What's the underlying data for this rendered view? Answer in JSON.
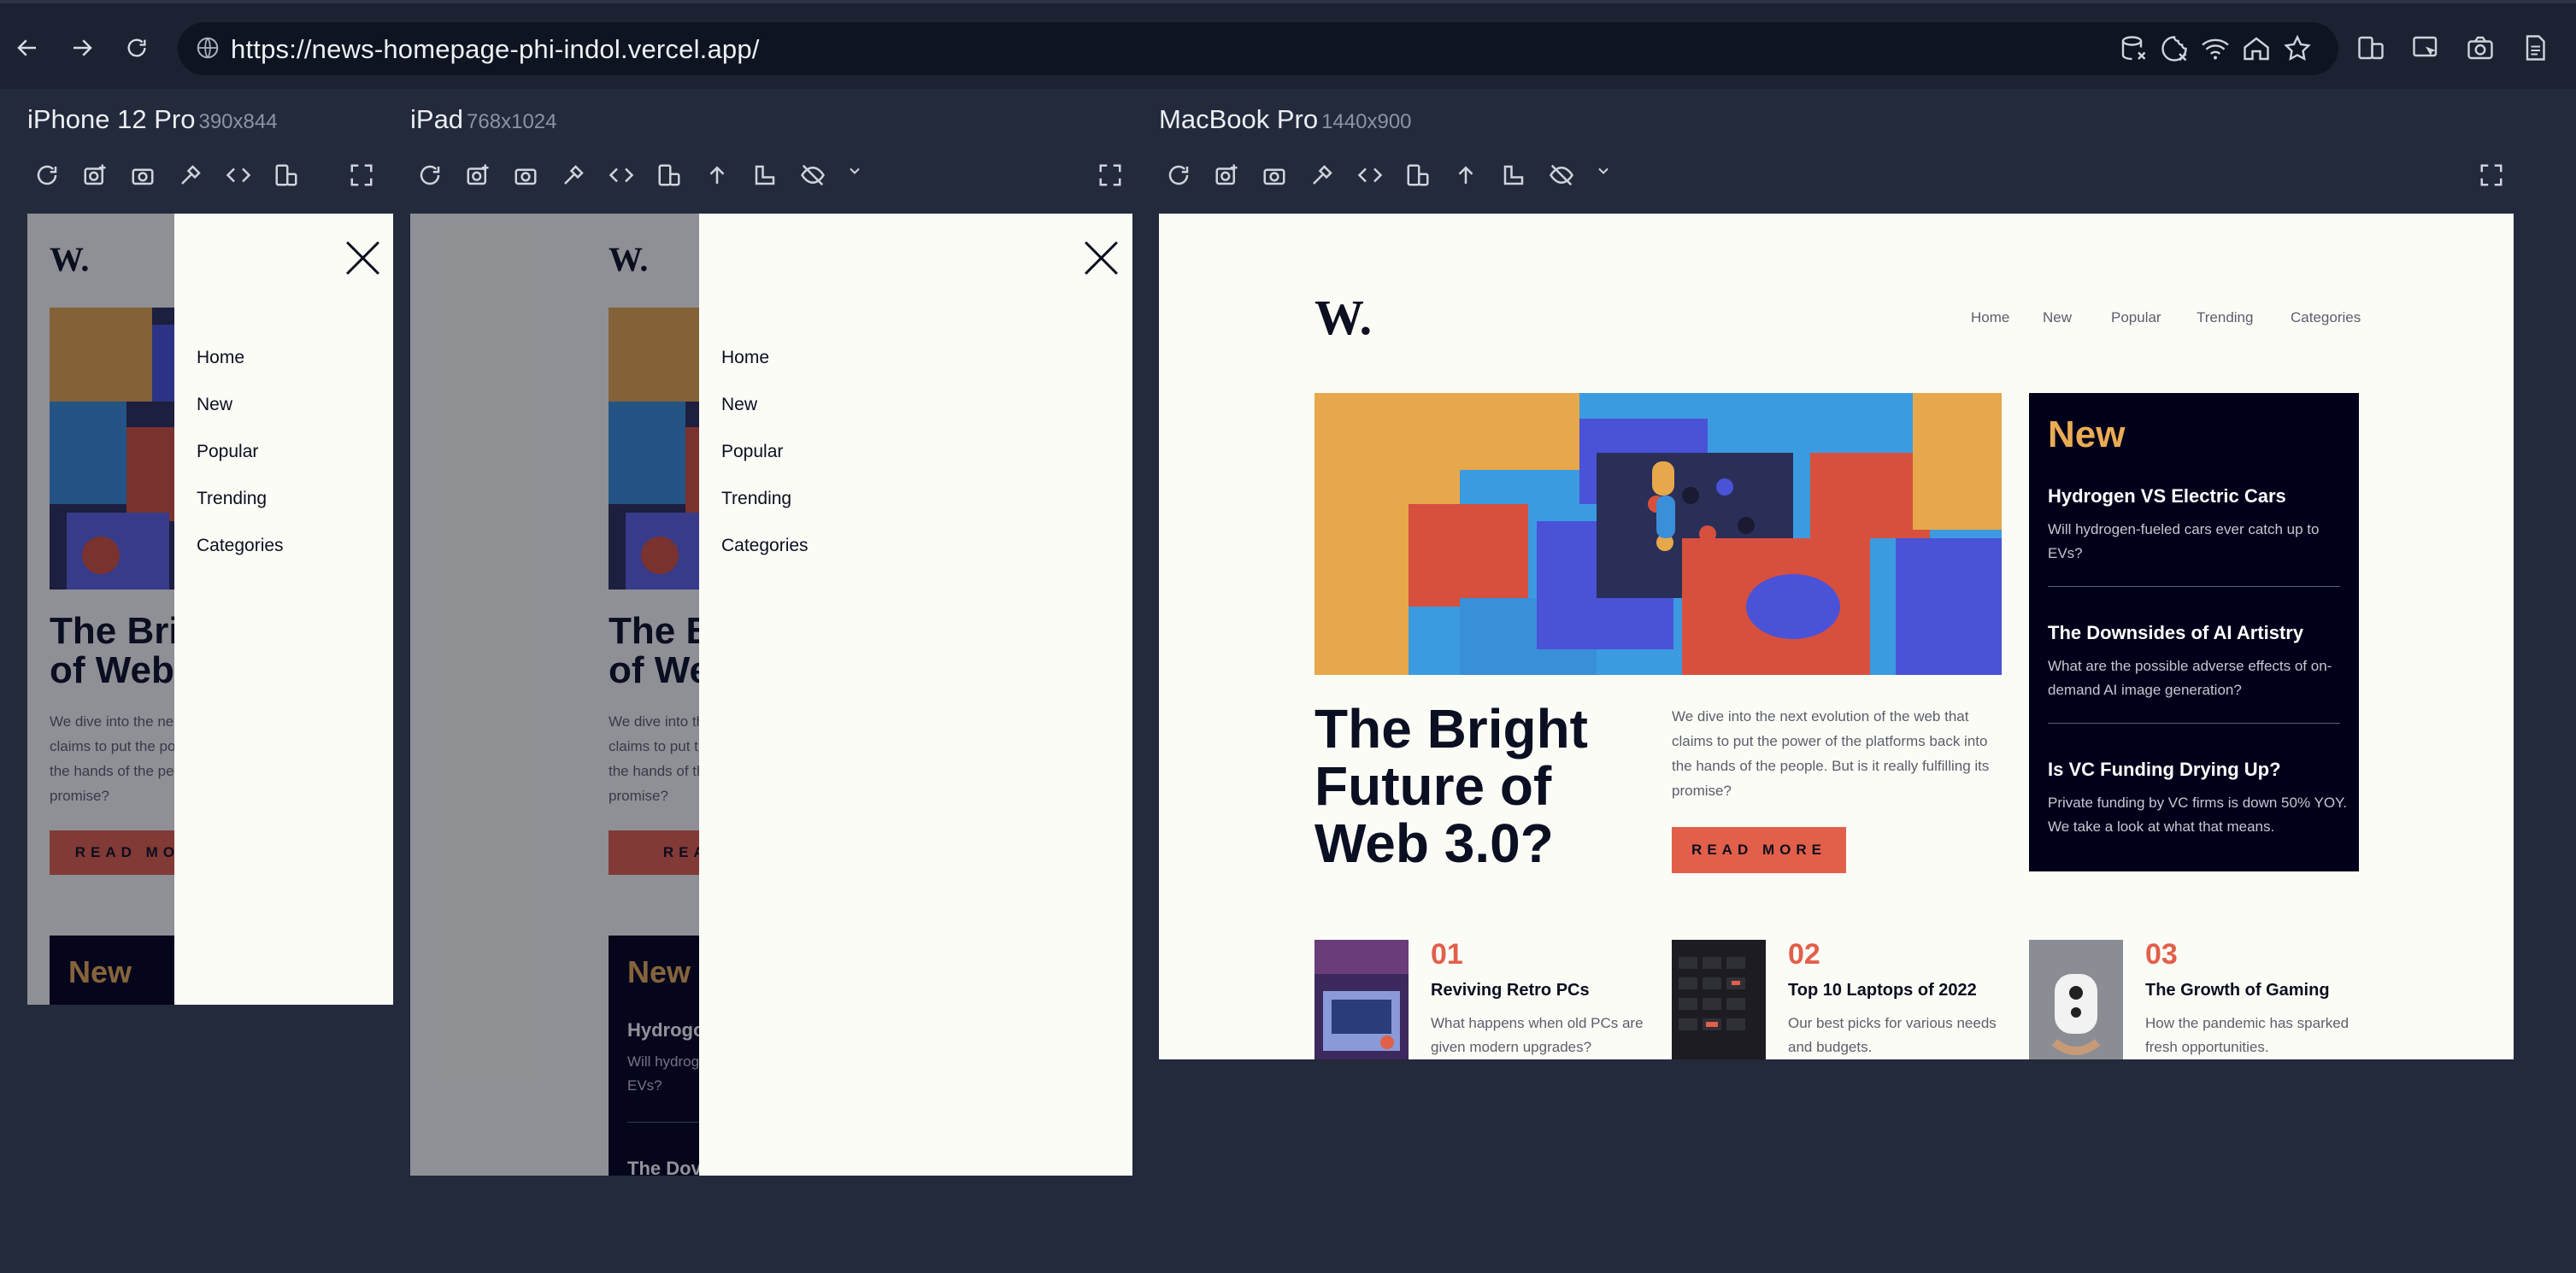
{
  "browser": {
    "url": "https://news-homepage-phi-indol.vercel.app/",
    "back_icon": "arrow-left-icon",
    "forward_icon": "arrow-right-icon",
    "reload_icon": "reload-icon"
  },
  "devices": [
    {
      "name": "iPhone 12 Pro",
      "size": "390x844"
    },
    {
      "name": "iPad",
      "size": "768x1024"
    },
    {
      "name": "MacBook Pro",
      "size": "1440x900"
    }
  ],
  "site": {
    "logo": "W.",
    "nav": [
      "Home",
      "New",
      "Popular",
      "Trending",
      "Categories"
    ],
    "hero": {
      "title_lines": [
        "The Bright",
        "Future of",
        "Web 3.0?"
      ],
      "mobile_title_lines": [
        "The Bri",
        "of Web"
      ],
      "ipad_title_lines": [
        "The B",
        "of We"
      ],
      "description": "We dive into the next evolution of the web that claims to put the power of the platforms back into the hands of the people. But is it really fulfilling its promise?",
      "desc_lines": [
        "We dive into the next evolution of the web that",
        "claims to put the power of the platforms back into",
        "the hands of the people. But is it really fulfilling its",
        "promise?"
      ],
      "mobile_desc_lines": [
        "We dive into the nex",
        "claims to put the pov",
        "the hands of the pec",
        "promise?"
      ],
      "ipad_desc_lines": [
        "We dive into th",
        "claims to put th",
        "the hands of th",
        "promise?"
      ],
      "button": "READ MORE",
      "mobile_button": "READ MOR",
      "ipad_button": "READ"
    },
    "new_section": {
      "title": "New",
      "ipad_peek": [
        "Hydrogo",
        "Will hydrog",
        "EVs?",
        "The Dov"
      ],
      "articles": [
        {
          "title": "Hydrogen VS Electric Cars",
          "desc_lines": [
            "Will hydrogen-fueled cars ever catch up to",
            "EVs?"
          ]
        },
        {
          "title": "The Downsides of AI Artistry",
          "desc_lines": [
            "What are the possible adverse effects of on-",
            "demand AI image generation?"
          ]
        },
        {
          "title": "Is VC Funding Drying Up?",
          "desc_lines": [
            "Private funding by VC firms is down 50% YOY.",
            "We take a look at what that means."
          ]
        }
      ]
    },
    "cards": [
      {
        "num": "01",
        "title": "Reviving Retro PCs",
        "desc_lines": [
          "What happens when old PCs are",
          "given modern upgrades?"
        ]
      },
      {
        "num": "02",
        "title": "Top 10 Laptops of 2022",
        "desc_lines": [
          "Our best picks for various needs",
          "and budgets."
        ]
      },
      {
        "num": "03",
        "title": "The Growth of Gaming",
        "desc_lines": [
          "How the pandemic has sparked",
          "fresh opportunities."
        ]
      }
    ]
  },
  "colors": {
    "accent": "#e25f4a",
    "new_gold": "#e9ab53",
    "dark_navy": "#00001a",
    "background": "#232a3b"
  }
}
